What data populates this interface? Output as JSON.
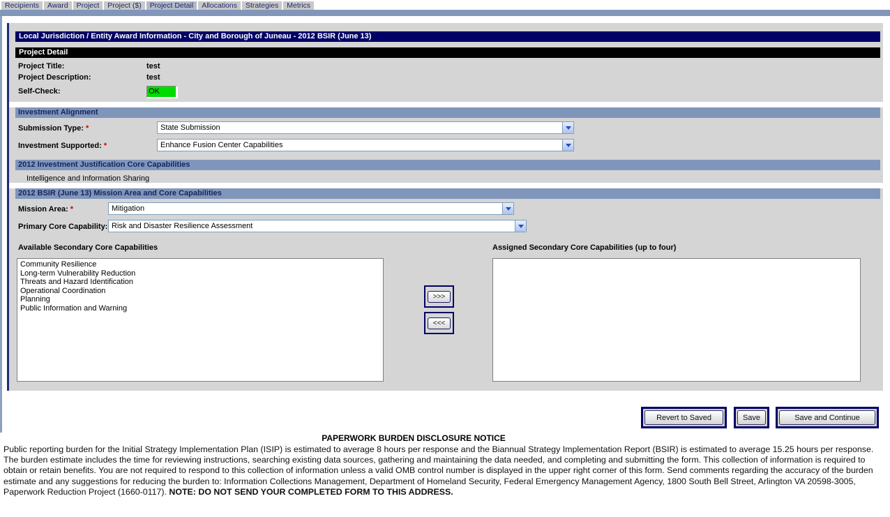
{
  "tabs": {
    "items": [
      {
        "label": "Recipients"
      },
      {
        "label": "Award"
      },
      {
        "label": "Project"
      },
      {
        "label": "Project ($)"
      },
      {
        "label": "Project Detail"
      },
      {
        "label": "Allocations"
      },
      {
        "label": "Strategies"
      },
      {
        "label": "Metrics"
      }
    ]
  },
  "required_marker": "*",
  "title_bar": {
    "text": "Local Jurisdiction / Entity Award Information - City and Borough of Juneau - 2012 BSIR (June 13)"
  },
  "project_detail": {
    "header": "Project Detail",
    "title_label": "Project Title:",
    "title_value": "test",
    "desc_label": "Project Description:",
    "desc_value": "test",
    "selfcheck_label": "Self-Check:",
    "selfcheck_value": "OK"
  },
  "investment_alignment": {
    "header": "Investment Alignment",
    "submission_type_label": "Submission Type:",
    "submission_type_value": "State Submission",
    "investment_supported_label": "Investment Supported:",
    "investment_supported_value": "Enhance Fusion Center Capabilities"
  },
  "ij_section": {
    "header": "2012 Investment Justification Core Capabilities",
    "value": "Intelligence and Information Sharing"
  },
  "bsir_section": {
    "header": "2012 BSIR (June 13) Mission Area and Core Capabilities",
    "mission_area_label": "Mission Area:",
    "mission_area_value": "Mitigation",
    "primary_core_label": "Primary Core Capability:",
    "primary_core_value": "Risk and Disaster Resilience Assessment",
    "available_label": "Available Secondary Core Capabilities",
    "assigned_label": "Assigned Secondary Core Capabilities (up to four)",
    "available_items": [
      "Community Resilience",
      "Long-term Vulnerability Reduction",
      "Threats and Hazard Identification",
      "Operational Coordination",
      "Planning",
      "Public Information and Warning"
    ],
    "assigned_items": [],
    "add_button": ">>>",
    "remove_button": "<<<"
  },
  "actions": {
    "revert": "Revert to Saved",
    "save": "Save",
    "save_continue": "Save and Continue"
  },
  "notice": {
    "title": "PAPERWORK BURDEN DISCLOSURE NOTICE",
    "body": "Public reporting burden for the Initial Strategy Implementation Plan (ISIP) is estimated to average 8 hours per response and the Biannual Strategy Implementation Report (BSIR) is estimated to average 15.25 hours per response. The burden estimate includes the time for reviewing instructions, searching existing data sources, gathering and maintaining the data needed, and completing and submitting the form. This collection of information is required to obtain or retain benefits. You are not required to respond to this collection of information unless a valid OMB control number is displayed in the upper right corner of this form. Send comments regarding the accuracy of the burden estimate and any suggestions for reducing the burden to: Information Collections Management, Department of Homeland Security, Federal Emergency Management Agency, 1800 South Bell Street, Arlington VA 20598-3005, Paperwork Reduction Project (1660-0117). ",
    "note": "NOTE: DO NOT SEND YOUR COMPLETED FORM TO THIS ADDRESS."
  }
}
